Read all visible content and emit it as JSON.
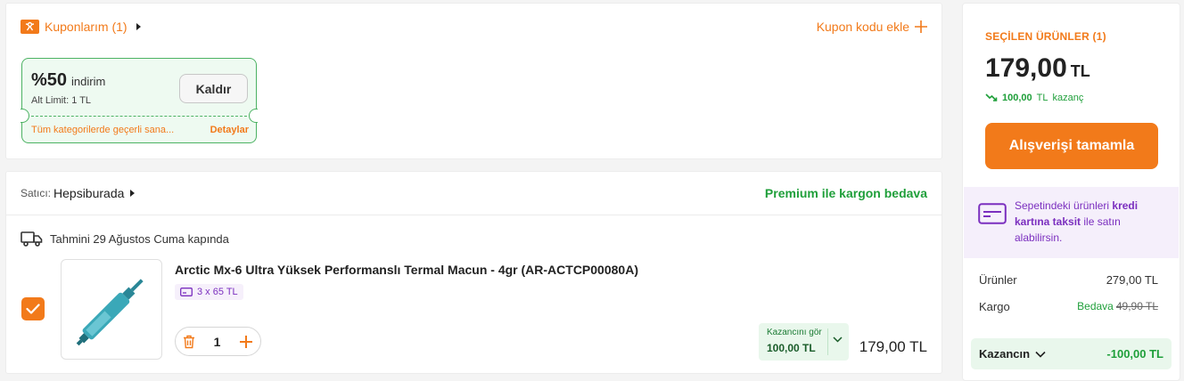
{
  "coupons": {
    "title": "Kuponlarım (1)",
    "add_label": "Kupon kodu ekle",
    "coupon": {
      "discount": "%50",
      "discount_word": "indirim",
      "limit": "Alt Limit: 1 TL",
      "remove_label": "Kaldır",
      "validity": "Tüm kategorilerde geçerli sana...",
      "details_label": "Detaylar"
    }
  },
  "seller": {
    "label": "Satıcı:",
    "name": "Hepsiburada",
    "shipping_note": "Premium ile kargon bedava",
    "delivery": "Tahmini 29 Ağustos Cuma kapında",
    "product": {
      "title": "Arctic Mx-6 Ultra Yüksek Performanslı Termal Macun - 4gr (AR-ACTCP00080A)",
      "installment": "3 x 65 TL",
      "quantity": "1",
      "earn_label": "Kazancını gör",
      "earn_value": "100,00 TL",
      "price": "179,00 TL",
      "checked": true
    }
  },
  "summary": {
    "selected_title": "SEÇİLEN ÜRÜNLER (1)",
    "total_amount": "179,00",
    "currency": "TL",
    "gain_amount": "100,00",
    "gain_currency": "TL",
    "gain_word": "kazanç",
    "checkout_label": "Alışverişi tamamla",
    "taksit_part1": "Sepetindeki ürünleri ",
    "taksit_bold": "kredi kartına taksit",
    "taksit_part2": " ile satın alabilirsin.",
    "rows": {
      "products_label": "Ürünler",
      "products_value": "279,00 TL",
      "cargo_label": "Kargo",
      "cargo_free": "Bedava",
      "cargo_old": "49,90 TL"
    },
    "gain_box_label": "Kazancın",
    "gain_box_value": "-100,00 TL"
  },
  "colors": {
    "accent": "#f27a1a",
    "success": "#1f9f3a",
    "purple": "#7b2fbf"
  }
}
